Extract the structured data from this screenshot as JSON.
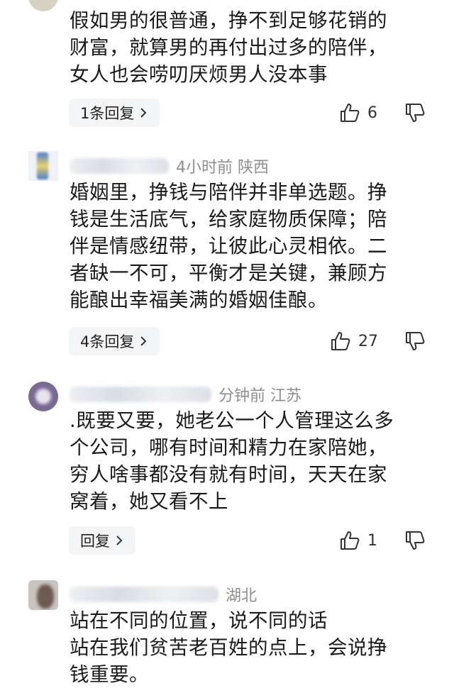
{
  "comments": [
    {
      "text_lines": [
        "假如男的很普通，挣不到足够花销的",
        "财富，就算男的再付出过多的陪伴，",
        "女人也会唠叨厌烦男人没本事"
      ],
      "reply_label": "1条回复",
      "likes": "6"
    },
    {
      "meta_suffix": "4小时前  陕西",
      "text_lines": [
        "婚姻里，挣钱与陪伴并非单选题。挣",
        "钱是生活底气，给家庭物质保障；陪",
        "伴是情感纽带，让彼此心灵相依。二",
        "者缺一不可，平衡才是关键，兼顾方",
        "能酿出幸福美满的婚姻佳酿。"
      ],
      "reply_label": "4条回复",
      "likes": "27"
    },
    {
      "meta_suffix": "分钟前  江苏",
      "text_lines": [
        ".既要又要，她老公一个人管理这么多",
        "个公司，哪有时间和精力在家陪她，",
        "穷人啥事都没有就有时间，天天在家",
        "窝着，她又看不上"
      ],
      "reply_label": "回复",
      "likes": "1"
    },
    {
      "meta_suffix": "湖北",
      "text_lines": [
        "站在不同的位置，说不同的话",
        "站在我们贫苦老百姓的点上，会说挣",
        "钱重要。"
      ]
    }
  ],
  "icons": {
    "like": "thumbs-up-icon",
    "dislike": "thumbs-down-icon",
    "more": "chevron-right-icon"
  },
  "colors": {
    "meta": "#8e8e8e",
    "reply_bg": "#f4f5f7",
    "text": "#1a1a1a"
  }
}
